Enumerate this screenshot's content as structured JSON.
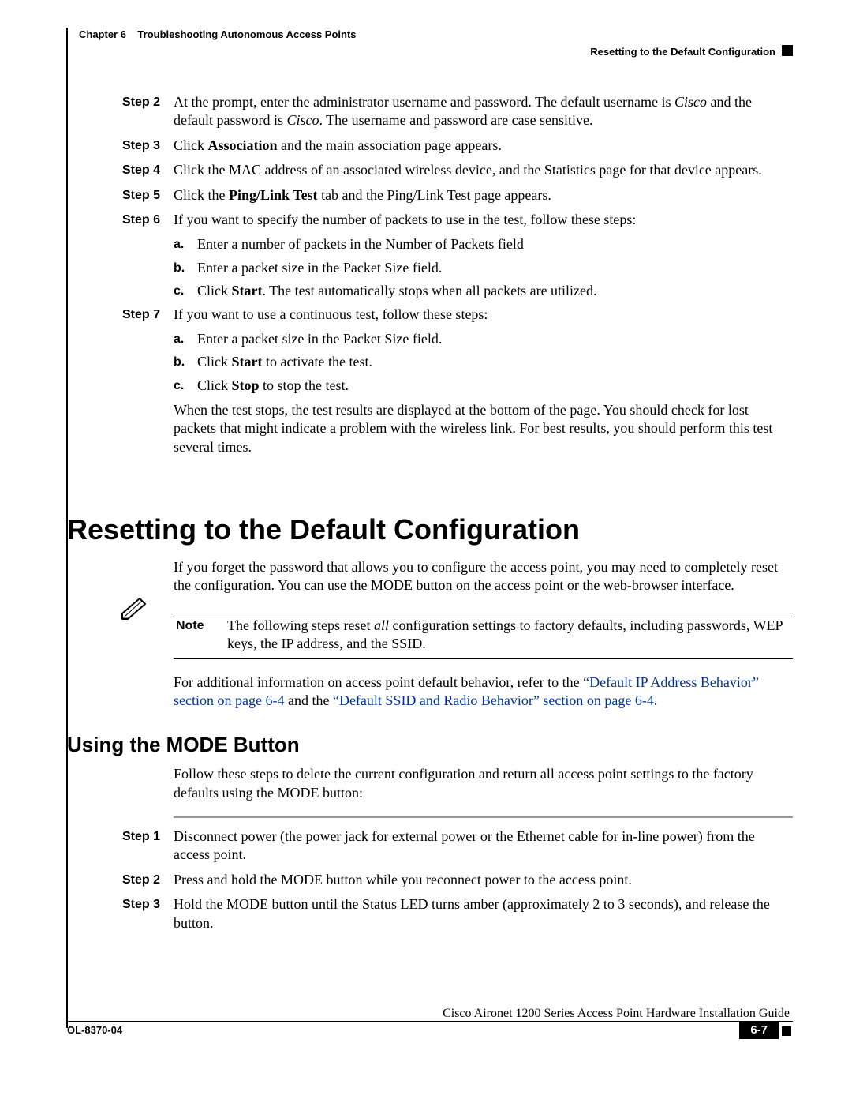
{
  "header": {
    "chapter_label": "Chapter 6",
    "chapter_title": "Troubleshooting Autonomous Access Points",
    "section_title": "Resetting to the Default Configuration"
  },
  "steps_a": [
    {
      "label": "Step 2",
      "body_pre": "At the prompt, enter the administrator username and password. The default username is ",
      "body_em1": "Cisco",
      "body_mid": " and the default password is ",
      "body_em2": "Cisco",
      "body_post": ". The username and password are case sensitive."
    },
    {
      "label": "Step 3",
      "body_pre": "Click ",
      "body_b1": "Association",
      "body_post": " and the main association page appears."
    },
    {
      "label": "Step 4",
      "body_plain": "Click the MAC address of an associated wireless device, and the Statistics page for that device appears."
    },
    {
      "label": "Step 5",
      "body_pre": "Click the ",
      "body_b1": "Ping/Link Test",
      "body_post": " tab and the Ping/Link Test page appears."
    },
    {
      "label": "Step 6",
      "body_plain": "If you want to specify the number of packets to use in the test, follow these steps:"
    }
  ],
  "sub_6": [
    {
      "letter": "a.",
      "text_plain": "Enter a number of packets in the Number of Packets field"
    },
    {
      "letter": "b.",
      "text_plain": "Enter a packet size in the Packet Size field."
    },
    {
      "letter": "c.",
      "text_pre": "Click ",
      "text_b1": "Start",
      "text_post": ". The test automatically stops when all packets are utilized."
    }
  ],
  "step7": {
    "label": "Step 7",
    "body_plain": "If you want to use a continuous test, follow these steps:"
  },
  "sub_7": [
    {
      "letter": "a.",
      "text_plain": "Enter a packet size in the Packet Size field."
    },
    {
      "letter": "b.",
      "text_pre": "Click ",
      "text_b1": "Start",
      "text_post": " to activate the test."
    },
    {
      "letter": "c.",
      "text_pre": "Click ",
      "text_b1": "Stop",
      "text_post": " to stop the test."
    }
  ],
  "para_after7": "When the test stops, the test results are displayed at the bottom of the page. You should check for lost packets that might indicate a problem with the wireless link. For best results, you should perform this test several times.",
  "h1": "Resetting to the Default Configuration",
  "h1_intro": "If you forget the password that allows you to configure the access point, you may need to completely reset the configuration. You can use the MODE button on the access point or the web-browser interface.",
  "note": {
    "label": "Note",
    "text_pre": "The following steps reset ",
    "text_em": "all",
    "text_post": " configuration settings to factory defaults, including passwords, WEP keys, the IP address, and the SSID."
  },
  "xref": {
    "pre": "For additional information on access point default behavior, refer to the ",
    "link1": "“Default IP Address Behavior” section on page 6-4",
    "mid": " and the ",
    "link2": "“Default SSID and Radio Behavior” section on page 6-4",
    "post": "."
  },
  "h2": "Using the MODE Button",
  "h2_intro": "Follow these steps to delete the current configuration and return all access point settings to the factory defaults using the MODE button:",
  "steps_b": [
    {
      "label": "Step 1",
      "body_plain": "Disconnect power (the power jack for external power or the Ethernet cable for in-line power) from the access point."
    },
    {
      "label": "Step 2",
      "body_plain": "Press and hold the MODE button while you reconnect power to the access point."
    },
    {
      "label": "Step 3",
      "body_plain": "Hold the MODE button until the Status LED turns amber (approximately 2 to 3 seconds), and release the button."
    }
  ],
  "footer": {
    "guide": "Cisco Aironet 1200 Series Access Point Hardware Installation Guide",
    "doc_id": "OL-8370-04",
    "page": "6-7"
  }
}
